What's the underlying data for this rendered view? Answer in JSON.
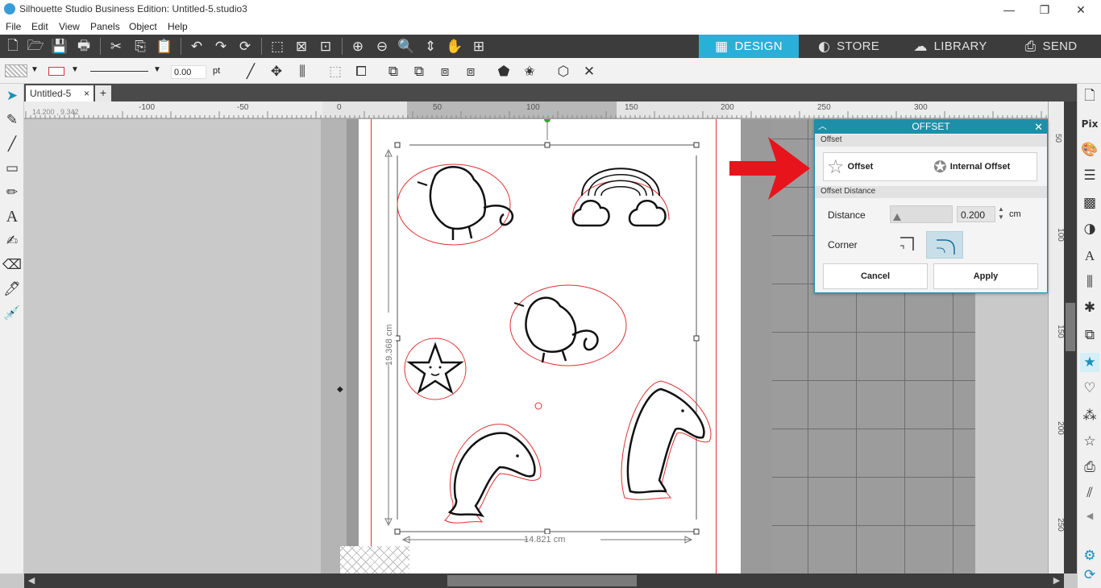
{
  "window": {
    "title": "Silhouette Studio Business Edition: Untitled-5.studio3",
    "minimize": "—",
    "restore": "❐",
    "close": "✕"
  },
  "menu": [
    "File",
    "Edit",
    "View",
    "Panels",
    "Object",
    "Help"
  ],
  "nav_tabs": [
    {
      "label": "DESIGN",
      "icon": "grid-icon",
      "active": true
    },
    {
      "label": "STORE",
      "icon": "silhouette-s-icon",
      "active": false
    },
    {
      "label": "LIBRARY",
      "icon": "cloud-icon",
      "active": false
    },
    {
      "label": "SEND",
      "icon": "cutter-icon",
      "active": false
    }
  ],
  "toolbar2": {
    "line_width_value": "0.00",
    "line_width_unit": "pt"
  },
  "document": {
    "tab_label": "Untitled-5",
    "tab_close": "×",
    "add_tab": "+"
  },
  "ruler": {
    "coords": "14.200 , 9.342",
    "top_labels": [
      "-100",
      "-50",
      "0",
      "50",
      "100",
      "150",
      "200",
      "250",
      "300"
    ],
    "right_labels": [
      "50",
      "100",
      "150",
      "200",
      "250"
    ]
  },
  "selection": {
    "height_label": "19.368 cm",
    "width_label": "14.821 cm"
  },
  "offset_panel": {
    "title": "OFFSET",
    "section_offset": "Offset",
    "offset_label": "Offset",
    "internal_offset_label": "Internal Offset",
    "section_distance": "Offset Distance",
    "distance_label": "Distance",
    "distance_value": "0.200",
    "distance_unit": "cm",
    "corner_label": "Corner",
    "cancel_label": "Cancel",
    "apply_label": "Apply"
  },
  "colors": {
    "accent": "#2ab0d8",
    "panel_header": "#1e8fa8",
    "cut_line": "#e03030",
    "arrow": "#e8141b"
  }
}
